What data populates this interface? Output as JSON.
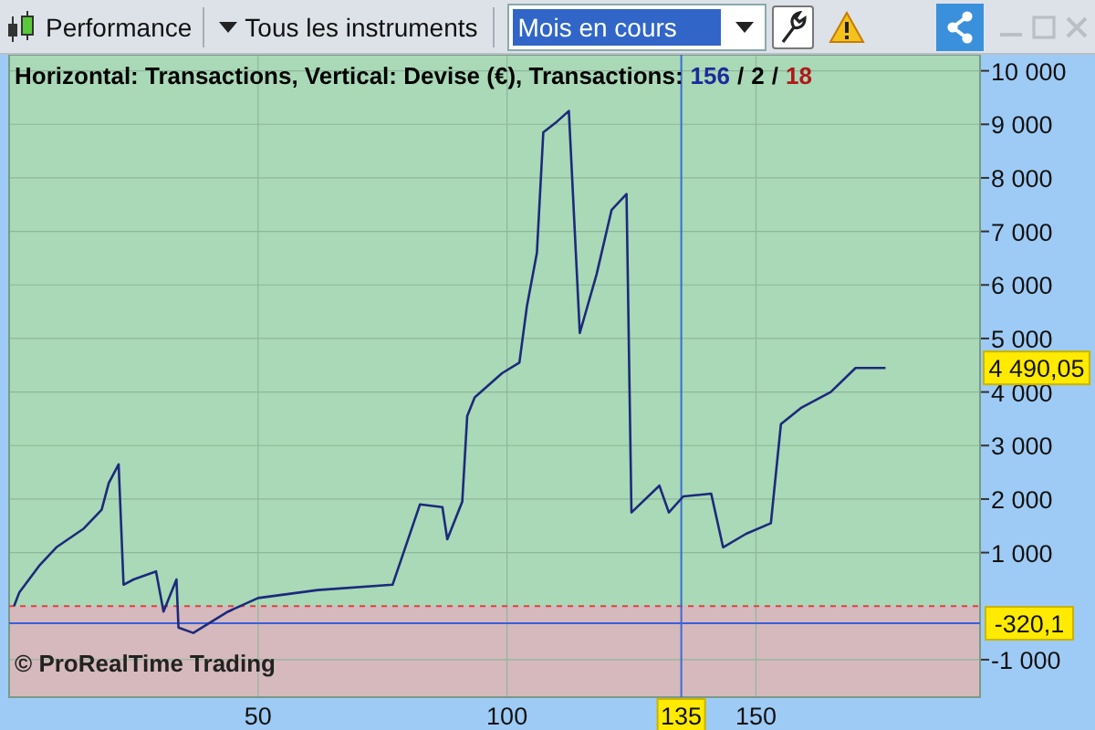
{
  "toolbar": {
    "title": "Performance",
    "instrument_menu": "Tous les instruments",
    "period_select": {
      "value": "Mois en cours"
    }
  },
  "chart": {
    "legend": {
      "text": "Horizontal: Transactions, Vertical: Devise (€), Transactions:",
      "separator": "/",
      "counts": [
        {
          "value": "156",
          "color": "#1c2a9c"
        },
        {
          "value": "2",
          "color": "#000000"
        },
        {
          "value": "18",
          "color": "#b01818"
        }
      ]
    },
    "watermark": "© ProRealTime Trading",
    "last_value_label": "4 490,05",
    "level_label": "-320,1",
    "cursor_label": "135",
    "chart_data": {
      "type": "line",
      "xlim": [
        0,
        195
      ],
      "ylim": [
        -1700,
        10300
      ],
      "grid": true,
      "bands": [
        {
          "axis": "y",
          "from": 0,
          "to": 10300,
          "color": "#a9d9b6"
        },
        {
          "axis": "y",
          "from": -1700,
          "to": 0,
          "color": "#d6b9bc"
        }
      ],
      "ref_lines": [
        {
          "axis": "y",
          "value": 0,
          "color": "#e04040"
        },
        {
          "axis": "y",
          "value": -320.1,
          "color": "#3a5ee0"
        },
        {
          "axis": "x",
          "value": 135,
          "color": "#3a6ad8"
        }
      ],
      "xticks": [
        50,
        100,
        150
      ],
      "yticks": [
        {
          "value": 10000,
          "label": "10 000"
        },
        {
          "value": 9000,
          "label": "9 000"
        },
        {
          "value": 8000,
          "label": "8 000"
        },
        {
          "value": 7000,
          "label": "7 000"
        },
        {
          "value": 6000,
          "label": "6 000"
        },
        {
          "value": 5000,
          "label": "5 000"
        },
        {
          "value": 4000,
          "label": "4 000"
        },
        {
          "value": 3000,
          "label": "3 000"
        },
        {
          "value": 2000,
          "label": "2 000"
        },
        {
          "value": 1000,
          "label": "1 000"
        },
        {
          "value": -1000,
          "label": "-1 000"
        }
      ],
      "x": [
        1,
        2,
        6,
        9.5,
        15,
        18.6,
        20,
        22,
        23,
        25,
        29.5,
        31,
        33.6,
        34,
        37,
        44,
        50,
        62,
        77,
        82.5,
        87,
        88,
        91,
        92,
        93.5,
        99,
        102.5,
        104,
        106,
        107.3,
        110,
        112.4,
        114.6,
        118,
        121,
        124,
        125,
        130.6,
        132.5,
        135.4,
        141,
        143.4,
        148,
        153,
        155,
        159,
        165,
        170,
        176
      ],
      "series": [
        {
          "color": "#1c2a7c",
          "values": [
            0,
            250,
            750,
            1100,
            1450,
            1800,
            2300,
            2650,
            400,
            500,
            650,
            -100,
            500,
            -400,
            -500,
            -100,
            150,
            300,
            400,
            1900,
            1850,
            1250,
            1950,
            3550,
            3900,
            4350,
            4550,
            5600,
            6600,
            8850,
            9050,
            9250,
            5100,
            6200,
            7400,
            7700,
            1750,
            2250,
            1750,
            2050,
            2100,
            1100,
            1350,
            1550,
            3400,
            3700,
            4000,
            4450,
            4450
          ]
        }
      ]
    }
  }
}
